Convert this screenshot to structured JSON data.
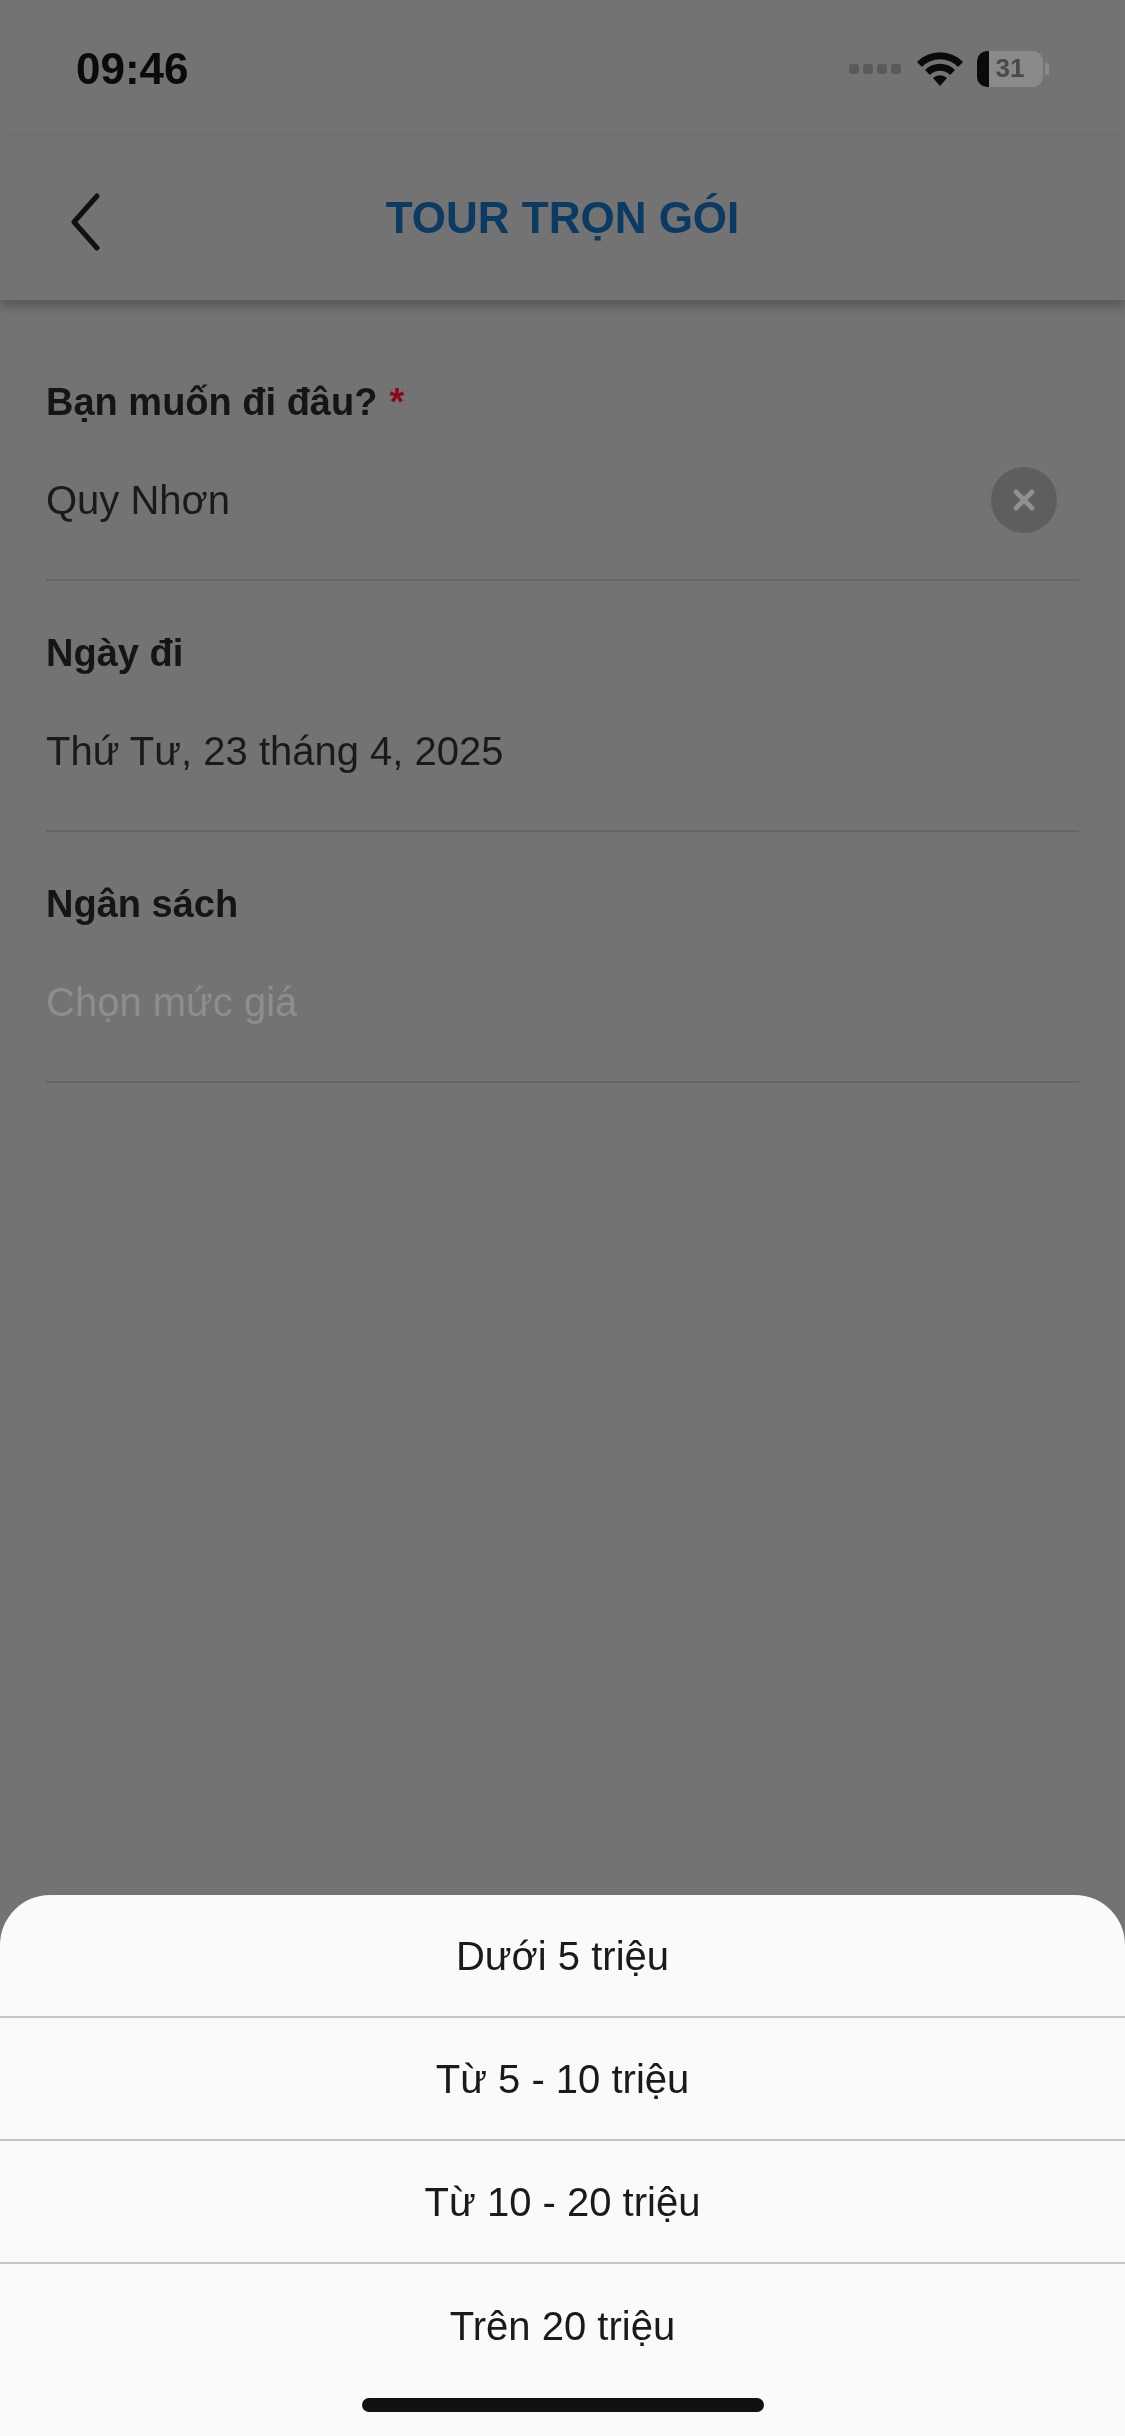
{
  "status_bar": {
    "time": "09:46",
    "battery": "31"
  },
  "header": {
    "title": "TOUR TRỌN GÓI"
  },
  "fields": [
    {
      "label": "Bạn muốn đi đâu?",
      "required_mark": "*",
      "value": "Quy Nhơn",
      "clearable": true
    },
    {
      "label": "Ngày đi",
      "value": "Thứ Tư, 23 tháng 4, 2025",
      "clearable": false
    },
    {
      "label": "Ngân sách",
      "placeholder": "Chọn mức giá",
      "clearable": false
    }
  ],
  "options": [
    {
      "label": "Dưới 5 triệu"
    },
    {
      "label": "Từ 5 - 10 triệu"
    },
    {
      "label": "Từ 10 - 20 triệu"
    },
    {
      "label": "Trên 20 triệu"
    }
  ]
}
